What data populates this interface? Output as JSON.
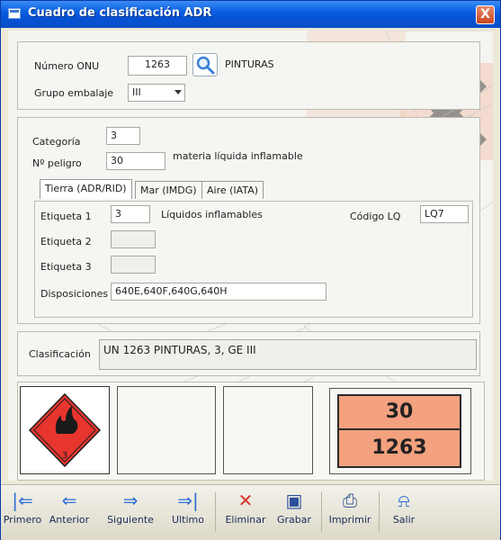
{
  "window": {
    "title": "Cuadro de clasificación ADR",
    "close_label": "X"
  },
  "identification": {
    "onu_label": "Número ONU",
    "onu_value": "1263",
    "substance_name": "PINTURAS",
    "packing_group_label": "Grupo embalaje",
    "packing_group_value": "III"
  },
  "hazard": {
    "category_label": "Categoría",
    "category_value": "3",
    "danger_label": "Nº peligro",
    "danger_value": "30",
    "danger_description": "materia líquida inflamable"
  },
  "tabs": [
    {
      "label": "Tierra (ADR/RID)"
    },
    {
      "label": "Mar (IMDG)"
    },
    {
      "label": "Aire (IATA)"
    }
  ],
  "tab_panel": {
    "etiqueta1_label": "Etiqueta 1",
    "etiqueta1_value": "3",
    "etiqueta1_desc": "Líquidos inflamables",
    "codigo_lq_label": "Código LQ",
    "codigo_lq_value": "LQ7",
    "etiqueta2_label": "Etiqueta 2",
    "etiqueta2_value": "",
    "etiqueta3_label": "Etiqueta 3",
    "etiqueta3_value": "",
    "disposiciones_label": "Disposiciones",
    "disposiciones_value": "640E,640F,640G,640H"
  },
  "classification": {
    "label": "Clasificación",
    "value": "UN 1263 PINTURAS, 3, GE III"
  },
  "placard": {
    "class_number": "3"
  },
  "orange_plate": {
    "top": "30",
    "bottom": "1263"
  },
  "toolbar": [
    {
      "label": "Primero",
      "icon": "first-arrow-icon"
    },
    {
      "label": "Anterior",
      "icon": "prev-arrow-icon"
    },
    {
      "label": "Siguiente",
      "icon": "next-arrow-icon"
    },
    {
      "label": "Ultimo",
      "icon": "last-arrow-icon"
    },
    {
      "label": "Eliminar",
      "icon": "delete-x-icon"
    },
    {
      "label": "Grabar",
      "icon": "save-disk-icon"
    },
    {
      "label": "Imprimir",
      "icon": "printer-icon"
    },
    {
      "label": "Salir",
      "icon": "exit-icon"
    }
  ],
  "colors": {
    "title_bar": "#0a5fe0",
    "diamond_red": "#e8352d",
    "orange_plate": "#f3a17f",
    "cross_dark": "#1a1a1a"
  }
}
